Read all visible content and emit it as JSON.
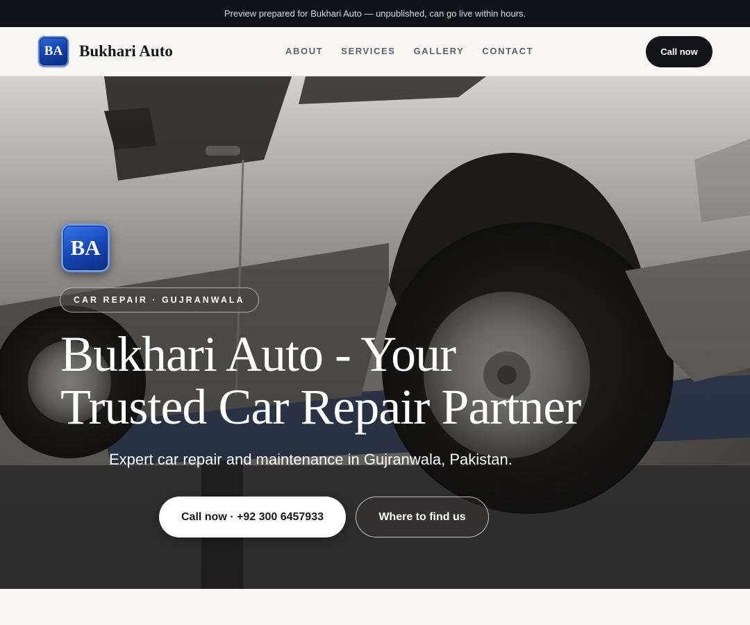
{
  "preview_banner": "Preview prepared for Bukhari Auto — unpublished, can go live within hours.",
  "nav": {
    "logo_initials": "BA",
    "brand_name": "Bukhari Auto",
    "links": [
      "ABOUT",
      "SERVICES",
      "GALLERY",
      "CONTACT"
    ],
    "call_label": "Call now"
  },
  "hero": {
    "logo_initials": "BA",
    "tagline": "CAR REPAIR · GUJRANWALA",
    "title_line1": "Bukhari Auto - Your",
    "title_line2": "Trusted Car Repair Partner",
    "subtitle": "Expert car repair and maintenance in Gujranwala, Pakistan.",
    "primary_button": "Call now · +92 300 6457933",
    "secondary_button": "Where to find us",
    "background_image": "white SUV raised on a car lift in a repair workshop"
  },
  "colors": {
    "top_banner_bg": "#111318",
    "page_bg": "#f8f7f4",
    "dark_button": "#141519",
    "logo_blue": "#1540a8"
  }
}
